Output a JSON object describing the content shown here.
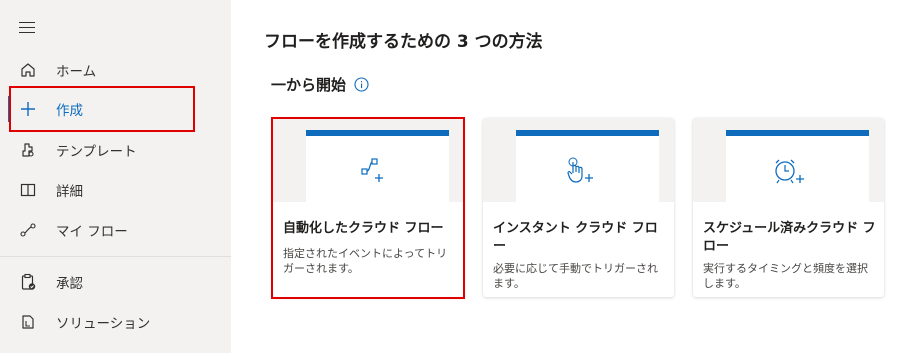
{
  "sidebar": {
    "menu_icon": "hamburger-menu-icon",
    "items": [
      {
        "label": "ホーム",
        "icon": "home-icon"
      },
      {
        "label": "作成",
        "icon": "plus-icon"
      },
      {
        "label": "テンプレート",
        "icon": "templates-icon"
      },
      {
        "label": "詳細",
        "icon": "book-icon"
      },
      {
        "label": "マイ フロー",
        "icon": "flow-icon"
      },
      {
        "label": "承認",
        "icon": "approvals-icon"
      },
      {
        "label": "ソリューション",
        "icon": "solutions-icon"
      }
    ]
  },
  "main": {
    "title": "フローを作成するための 3 つの方法",
    "section_title": "一から開始",
    "cards": [
      {
        "title": "自動化したクラウド フロー",
        "description": "指定されたイベントによってトリガーされます。",
        "icon": "automated-flow-icon"
      },
      {
        "title": "インスタント クラウド フロー",
        "description": "必要に応じて手動でトリガーされます。",
        "icon": "touch-hand-icon"
      },
      {
        "title": "スケジュール済みクラウド フロー",
        "description": "実行するタイミングと頻度を選択します。",
        "icon": "alarm-clock-icon"
      }
    ]
  },
  "colors": {
    "accent": "#0f6cbd",
    "highlight": "#e00000",
    "sidebar_bg": "#f3f2f1"
  }
}
